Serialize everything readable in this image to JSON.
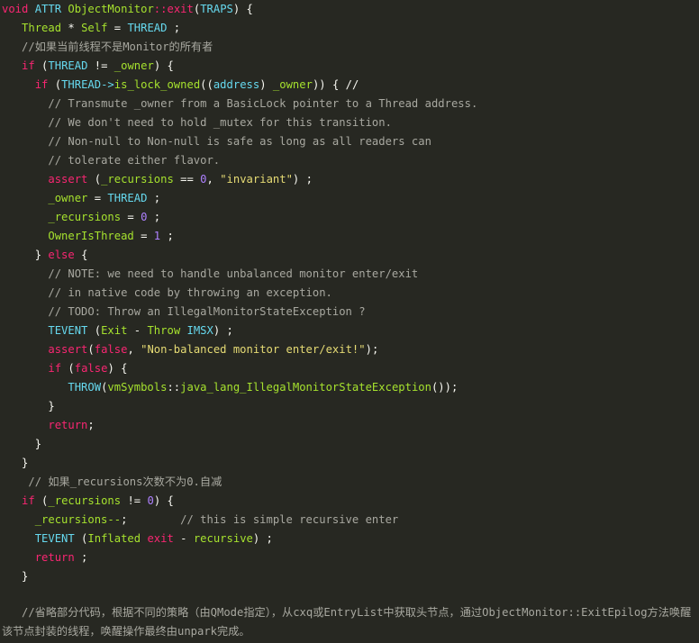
{
  "code_lines": [
    [
      [
        "void",
        "kw"
      ],
      [
        " ",
        "pl"
      ],
      [
        "ATTR",
        "fn"
      ],
      [
        " ",
        "pl"
      ],
      [
        "ObjectMonitor",
        "ty"
      ],
      [
        "::",
        "kw"
      ],
      [
        "exit",
        "kw"
      ],
      [
        "(",
        "pl"
      ],
      [
        "TRAPS",
        "fn"
      ],
      [
        ") {",
        "pl"
      ]
    ],
    [
      [
        "   ",
        "pl"
      ],
      [
        "Thread",
        "ty"
      ],
      [
        " * ",
        "pl"
      ],
      [
        "Self",
        "ty"
      ],
      [
        " = ",
        "pl"
      ],
      [
        "THREAD",
        "fn"
      ],
      [
        " ;",
        "pl"
      ]
    ],
    [
      [
        "   ",
        "pl"
      ],
      [
        "//如果当前线程不是Monitor的所有者",
        "cm"
      ]
    ],
    [
      [
        "   ",
        "pl"
      ],
      [
        "if",
        "kw"
      ],
      [
        " (",
        "pl"
      ],
      [
        "THREAD",
        "fn"
      ],
      [
        " != ",
        "pl"
      ],
      [
        "_owner",
        "ty"
      ],
      [
        ") {",
        "pl"
      ]
    ],
    [
      [
        "     ",
        "pl"
      ],
      [
        "if",
        "kw"
      ],
      [
        " (",
        "pl"
      ],
      [
        "THREAD->",
        "fn"
      ],
      [
        "is_lock_owned",
        "ty"
      ],
      [
        "((",
        "pl"
      ],
      [
        "address",
        "fn"
      ],
      [
        ") ",
        "pl"
      ],
      [
        "_owner",
        "ty"
      ],
      [
        ")) { //",
        "pl"
      ]
    ],
    [
      [
        "       ",
        "pl"
      ],
      [
        "// Transmute _owner from a BasicLock pointer to a Thread address.",
        "cm"
      ]
    ],
    [
      [
        "       ",
        "pl"
      ],
      [
        "// We don't need to hold _mutex for this transition.",
        "cm"
      ]
    ],
    [
      [
        "       ",
        "pl"
      ],
      [
        "// Non-null to Non-null is safe as long as all readers can",
        "cm"
      ]
    ],
    [
      [
        "       ",
        "pl"
      ],
      [
        "// tolerate either flavor.",
        "cm"
      ]
    ],
    [
      [
        "       ",
        "pl"
      ],
      [
        "assert",
        "kw"
      ],
      [
        " (",
        "pl"
      ],
      [
        "_recursions",
        "ty"
      ],
      [
        " == ",
        "pl"
      ],
      [
        "0",
        "num"
      ],
      [
        ", ",
        "pl"
      ],
      [
        "\"invariant\"",
        "str"
      ],
      [
        ") ;",
        "pl"
      ]
    ],
    [
      [
        "       ",
        "pl"
      ],
      [
        "_owner",
        "ty"
      ],
      [
        " = ",
        "pl"
      ],
      [
        "THREAD",
        "fn"
      ],
      [
        " ;",
        "pl"
      ]
    ],
    [
      [
        "       ",
        "pl"
      ],
      [
        "_recursions",
        "ty"
      ],
      [
        " = ",
        "pl"
      ],
      [
        "0",
        "num"
      ],
      [
        " ;",
        "pl"
      ]
    ],
    [
      [
        "       ",
        "pl"
      ],
      [
        "OwnerIsThread",
        "ty"
      ],
      [
        " = ",
        "pl"
      ],
      [
        "1",
        "num"
      ],
      [
        " ;",
        "pl"
      ]
    ],
    [
      [
        "     ",
        "pl"
      ],
      [
        "} ",
        "pl"
      ],
      [
        "else",
        "kw"
      ],
      [
        " {",
        "pl"
      ]
    ],
    [
      [
        "       ",
        "pl"
      ],
      [
        "// NOTE: we need to handle unbalanced monitor enter/exit",
        "cm"
      ]
    ],
    [
      [
        "       ",
        "pl"
      ],
      [
        "// in native code by throwing an exception.",
        "cm"
      ]
    ],
    [
      [
        "       ",
        "pl"
      ],
      [
        "// TODO: Throw an IllegalMonitorStateException ?",
        "cm"
      ]
    ],
    [
      [
        "       ",
        "pl"
      ],
      [
        "TEVENT",
        "fn"
      ],
      [
        " (",
        "pl"
      ],
      [
        "Exit",
        "ty"
      ],
      [
        " - ",
        "pl"
      ],
      [
        "Throw",
        "ty"
      ],
      [
        " ",
        "pl"
      ],
      [
        "IMSX",
        "fn"
      ],
      [
        ") ;",
        "pl"
      ]
    ],
    [
      [
        "       ",
        "pl"
      ],
      [
        "assert",
        "kw"
      ],
      [
        "(",
        "pl"
      ],
      [
        "false",
        "kw"
      ],
      [
        ", ",
        "pl"
      ],
      [
        "\"Non-balanced monitor enter/exit!\"",
        "str"
      ],
      [
        ");",
        "pl"
      ]
    ],
    [
      [
        "       ",
        "pl"
      ],
      [
        "if",
        "kw"
      ],
      [
        " (",
        "pl"
      ],
      [
        "false",
        "kw"
      ],
      [
        ") {",
        "pl"
      ]
    ],
    [
      [
        "          ",
        "pl"
      ],
      [
        "THROW",
        "fn"
      ],
      [
        "(",
        "pl"
      ],
      [
        "vmSymbols",
        "ty"
      ],
      [
        "::",
        "pl"
      ],
      [
        "java_lang_IllegalMonitorStateException",
        "ty"
      ],
      [
        "());",
        "pl"
      ]
    ],
    [
      [
        "       ",
        "pl"
      ],
      [
        "}",
        "pl"
      ]
    ],
    [
      [
        "       ",
        "pl"
      ],
      [
        "return",
        "kw"
      ],
      [
        ";",
        "pl"
      ]
    ],
    [
      [
        "     ",
        "pl"
      ],
      [
        "}",
        "pl"
      ]
    ],
    [
      [
        "   ",
        "pl"
      ],
      [
        "}",
        "pl"
      ]
    ],
    [
      [
        "    ",
        "pl"
      ],
      [
        "// 如果_recursions次数不为0.自减",
        "cm"
      ]
    ],
    [
      [
        "   ",
        "pl"
      ],
      [
        "if",
        "kw"
      ],
      [
        " (",
        "pl"
      ],
      [
        "_recursions",
        "ty"
      ],
      [
        " != ",
        "pl"
      ],
      [
        "0",
        "num"
      ],
      [
        ") {",
        "pl"
      ]
    ],
    [
      [
        "     ",
        "pl"
      ],
      [
        "_recursions--",
        "ty"
      ],
      [
        ";",
        "pl"
      ],
      [
        "        ",
        "pl"
      ],
      [
        "// this is simple recursive enter",
        "cm"
      ]
    ],
    [
      [
        "     ",
        "pl"
      ],
      [
        "TEVENT",
        "fn"
      ],
      [
        " (",
        "pl"
      ],
      [
        "Inflated",
        "ty"
      ],
      [
        " ",
        "pl"
      ],
      [
        "exit",
        "kw"
      ],
      [
        " - ",
        "pl"
      ],
      [
        "recursive",
        "ty"
      ],
      [
        ") ;",
        "pl"
      ]
    ],
    [
      [
        "     ",
        "pl"
      ],
      [
        "return",
        "kw"
      ],
      [
        " ;",
        "pl"
      ]
    ],
    [
      [
        "   ",
        "pl"
      ],
      [
        "}",
        "pl"
      ]
    ],
    [
      [
        "",
        "pl"
      ]
    ]
  ],
  "note": "//省略部分代码，根据不同的策略（由QMode指定），从cxq或EntryList中获取头节点，通过ObjectMonitor::ExitEpilog方法唤醒该节点封装的线程，唤醒操作最终由unpark完成。",
  "colors": {
    "background": "#272822",
    "keyword": "#f92672",
    "function": "#66d9ef",
    "type": "#a6e22e",
    "comment": "#a8a8a0",
    "string": "#e6db74",
    "number": "#ae81ff",
    "plain": "#f8f8f2"
  }
}
